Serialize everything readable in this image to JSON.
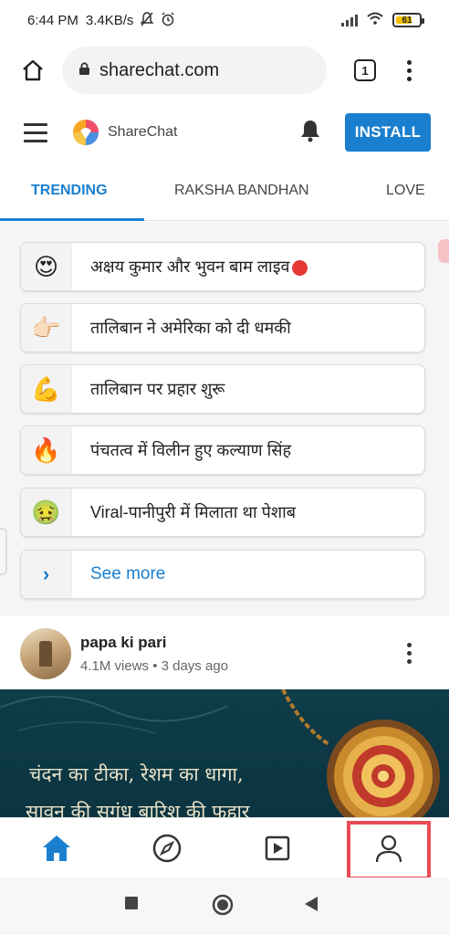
{
  "status_bar": {
    "time": "6:44 PM",
    "speed": "3.4KB/s",
    "battery_level": "61"
  },
  "browser": {
    "url": "sharechat.com",
    "tab_count": "1"
  },
  "app": {
    "logo_text": "ShareChat",
    "install_label": "INSTALL",
    "accent_color": "#1a7fcf"
  },
  "tabs": [
    {
      "label": "TRENDING",
      "active": true
    },
    {
      "label": "RAKSHA BANDHAN",
      "active": false
    },
    {
      "label": "LOVE",
      "active": false
    }
  ],
  "trending": [
    {
      "emoji": "😍",
      "text": "अक्षय कुमार और भुवन बाम लाइव",
      "live": true
    },
    {
      "emoji": "👉🏻",
      "text": "तालिबान ने अमेरिका को दी धमकी",
      "live": false
    },
    {
      "emoji": "💪",
      "text": "तालिबान पर प्रहार शुरू",
      "live": false
    },
    {
      "emoji": "🔥",
      "text": "पंचतत्व में विलीन हुए कल्याण सिंह",
      "live": false
    },
    {
      "emoji": "🤢",
      "text": "Viral-पानीपुरी में मिलाता था पेशाब",
      "live": false
    }
  ],
  "see_more": {
    "icon": "›",
    "label": "See more"
  },
  "post": {
    "username": "papa ki pari",
    "meta": "4.1M views • 3 days ago",
    "image_line1": "चंदन का टीका, रेशम का धागा,",
    "image_line2": "सावन की सुगंध बारिश की फुहार"
  },
  "bottom_nav": {
    "items": [
      "home-icon",
      "compass-icon",
      "video-icon",
      "profile-icon"
    ],
    "highlight_color": "#e94b57"
  }
}
